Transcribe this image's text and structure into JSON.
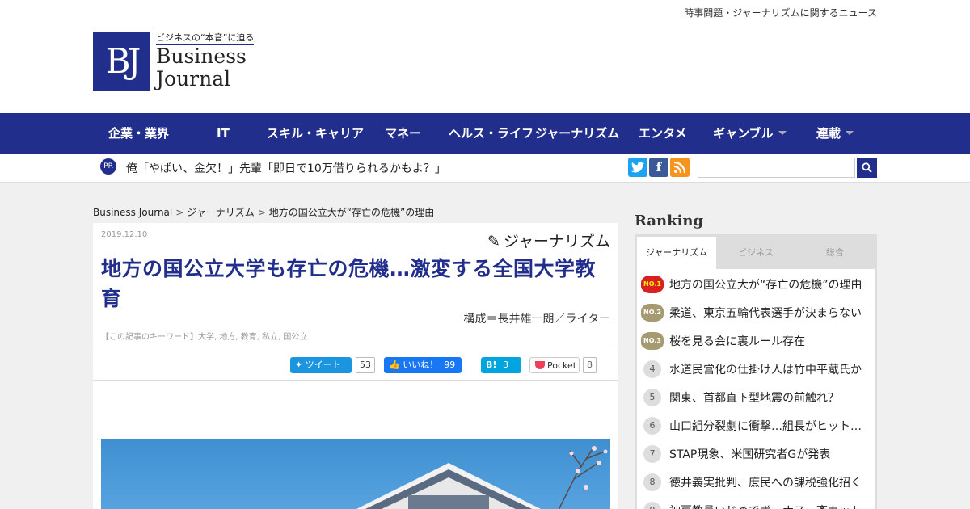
{
  "header": {
    "tagline": "時事問題・ジャーナリズムに関するニュース",
    "logo": {
      "mark": "BJ",
      "tagline": "ビジネスの“本音”に迫る",
      "name_line1": "Business",
      "name_line2": "Journal"
    }
  },
  "nav": {
    "items": [
      {
        "label": "企業・業界"
      },
      {
        "label": "IT"
      },
      {
        "label": "スキル・キャリア"
      },
      {
        "label": "マネー"
      },
      {
        "label": "ヘルス・ライフ"
      },
      {
        "label": "ジャーナリズム"
      },
      {
        "label": "エンタメ"
      },
      {
        "label": "ギャンブル"
      },
      {
        "label": "連載"
      }
    ]
  },
  "pr": {
    "badge": "PR",
    "text": "俺「やばい、金欠！」先輩「即日で10万借りられるかもよ？」"
  },
  "breadcrumb": {
    "home": "Business Journal",
    "sep": ">",
    "section": "ジャーナリズム",
    "current": "地方の国公立大が“存亡の危機”の理由"
  },
  "article": {
    "date": "2019.12.10",
    "category": "ジャーナリズム",
    "title": "地方の国公立大学も存亡の危機…激変する全国大学教育",
    "byline": "構成＝長井雄一朗／ライター",
    "keywords": "【この記事のキーワード】大学, 地方, 教育, 私立, 国公立"
  },
  "share": {
    "tweet_label": "ツイート",
    "tweet_count": "53",
    "like_label": "いいね！",
    "like_count": "99",
    "hatena_label": "B!",
    "hatena_count": "3",
    "pocket_label": "Pocket",
    "pocket_count": "8"
  },
  "ranking": {
    "title": "Ranking",
    "tabs": [
      {
        "label": "ジャーナリズム"
      },
      {
        "label": "ビジネス"
      },
      {
        "label": "総合"
      }
    ],
    "items": [
      {
        "rank": "NO.1",
        "text": "地方の国公立大が“存亡の危機”の理由"
      },
      {
        "rank": "NO.2",
        "text": "柔道、東京五輪代表選手が決まらない"
      },
      {
        "rank": "NO.3",
        "text": "桜を見る会に裏ルール存在"
      },
      {
        "rank": "4",
        "text": "水道民営化の仕掛け人は竹中平蔵氏か"
      },
      {
        "rank": "5",
        "text": "関東、首都直下型地震の前触れ？"
      },
      {
        "rank": "6",
        "text": "山口組分裂劇に衝撃…組長がヒットマン"
      },
      {
        "rank": "7",
        "text": "STAP現象、米国研究者Gが発表"
      },
      {
        "rank": "8",
        "text": "徳井義実批判、庶民への課税強化招く"
      },
      {
        "rank": "9",
        "text": "神戸教員いじめでボーナス一斉カット"
      }
    ]
  },
  "colors": {
    "brand_navy": "#222e8c",
    "twitter": "#1b95e0",
    "facebook": "#1877f2",
    "hatena": "#00a4de",
    "rss": "#f7941e"
  }
}
